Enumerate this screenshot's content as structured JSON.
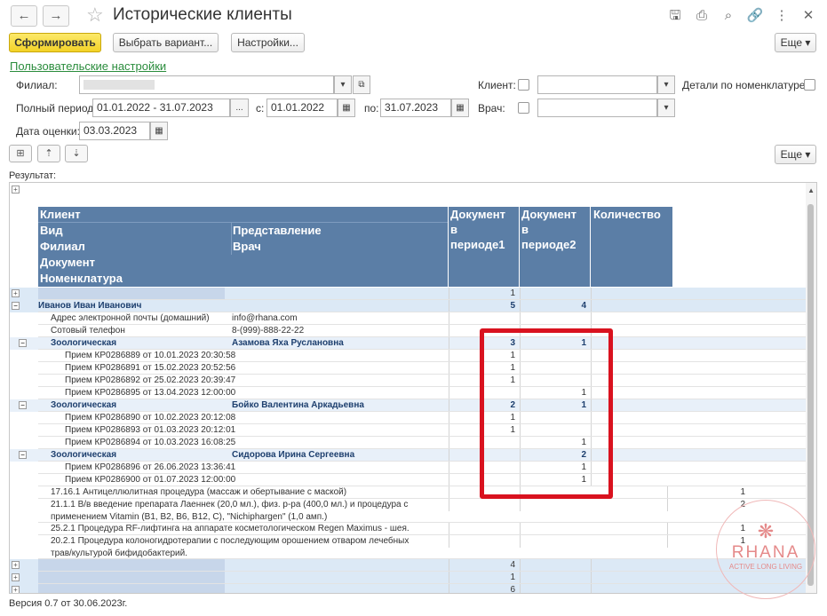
{
  "window": {
    "title": "Исторические клиенты",
    "nav_back": "←",
    "nav_forward": "→",
    "star": "☆",
    "icons": [
      "save-icon",
      "print-icon",
      "preview-icon",
      "link-icon",
      "more-icon",
      "close-icon"
    ],
    "icon_glyphs": [
      "🖫",
      "⎙",
      "⌕",
      "🔗",
      "⋮",
      "✕"
    ]
  },
  "toolbar": {
    "generate_label": "Сформировать",
    "variant_label": "Выбрать вариант...",
    "settings_label": "Настройки...",
    "more_label": "Еще ▾"
  },
  "user_settings_link": "Пользовательские настройки",
  "filters": {
    "branch_label": "Филиал:",
    "branch_value": "",
    "full_period_label": "Полный период:",
    "full_period_value": "01.01.2022 - 31.07.2023",
    "period_btn": "...",
    "from_label": "с:",
    "from_value": "01.01.2022",
    "to_label": "по:",
    "to_value": "31.07.2023",
    "assess_date_label": "Дата оценки:",
    "assess_date_value": "03.03.2023",
    "client_label": "Клиент:",
    "doctor_label": "Врач:",
    "details_label": "Детали по номенклатуре:"
  },
  "result_label": "Результат:",
  "more2_label": "Еще ▾",
  "table": {
    "headers": {
      "client": "Клиент",
      "kind": "Вид",
      "representation": "Представление",
      "branch": "Филиал",
      "doctor": "Врач",
      "document": "Документ",
      "nomenclature": "Номенклатура",
      "doc_period1": [
        "Документ",
        "в",
        "периоде1"
      ],
      "doc_period2": [
        "Документ",
        "в",
        "периоде2"
      ],
      "quantity": "Количество"
    },
    "rows": [
      {
        "type": "blur",
        "a": "",
        "b": "",
        "p1": "1",
        "p2": "",
        "q": ""
      },
      {
        "type": "client",
        "a": "Иванов Иван Иванович",
        "b": "",
        "p1": "5",
        "p2": "4",
        "q": ""
      },
      {
        "type": "info",
        "a": "Адрес электронной почты (домашний)",
        "b": "info@rhana.com",
        "p1": "",
        "p2": "",
        "q": ""
      },
      {
        "type": "info",
        "a": "Сотовый телефон",
        "b": "8-(999)-888-22-22",
        "p1": "",
        "p2": "",
        "q": ""
      },
      {
        "type": "group",
        "a": "Зоологическая",
        "b": "Азамова Яха Руслановна",
        "p1": "3",
        "p2": "1",
        "q": ""
      },
      {
        "type": "doc",
        "a": "Прием КР0286889 от 10.01.2023 20:30:58",
        "b": "",
        "p1": "1",
        "p2": "",
        "q": ""
      },
      {
        "type": "doc",
        "a": "Прием КР0286891 от 15.02.2023 20:52:56",
        "b": "",
        "p1": "1",
        "p2": "",
        "q": ""
      },
      {
        "type": "doc",
        "a": "Прием КР0286892 от 25.02.2023 20:39:47",
        "b": "",
        "p1": "1",
        "p2": "",
        "q": ""
      },
      {
        "type": "doc",
        "a": "Прием КР0286895 от 13.04.2023 12:00:00",
        "b": "",
        "p1": "",
        "p2": "1",
        "q": ""
      },
      {
        "type": "group",
        "a": "Зоологическая",
        "b": "Бойко Валентина Аркадьевна",
        "p1": "2",
        "p2": "1",
        "q": ""
      },
      {
        "type": "doc",
        "a": "Прием КР0286890 от 10.02.2023 20:12:08",
        "b": "",
        "p1": "1",
        "p2": "",
        "q": ""
      },
      {
        "type": "doc",
        "a": "Прием КР0286893 от 01.03.2023 20:12:01",
        "b": "",
        "p1": "1",
        "p2": "",
        "q": ""
      },
      {
        "type": "doc",
        "a": "Прием КР0286894 от 10.03.2023 16:08:25",
        "b": "",
        "p1": "",
        "p2": "1",
        "q": ""
      },
      {
        "type": "group",
        "a": "Зоологическая",
        "b": "Сидорова Ирина Сергеевна",
        "p1": "",
        "p2": "2",
        "q": ""
      },
      {
        "type": "doc",
        "a": "Прием КР0286896 от 26.06.2023 13:36:41",
        "b": "",
        "p1": "",
        "p2": "1",
        "q": ""
      },
      {
        "type": "doc",
        "a": "Прием КР0286900 от 01.07.2023 12:00:00",
        "b": "",
        "p1": "",
        "p2": "1",
        "q": ""
      },
      {
        "type": "nom",
        "a": "17.16.1 Антицеллюлитная процедура (массаж и обертывание с маской)",
        "b": "",
        "p1": "",
        "p2": "",
        "q": "1"
      },
      {
        "type": "nom2",
        "a": "21.1.1 В/в введение препарата Лаеннек (20,0 мл.), физ. р-ра (400,0 мл.) и процедура с",
        "a2": "применением Vitamin (B1, B2, B6, B12, C), \"Nichiphargen\" (1,0 амп.)",
        "b": "",
        "p1": "",
        "p2": "",
        "q": "2"
      },
      {
        "type": "nom",
        "a": "25.2.1 Процедура RF-лифтинга на  аппарате  косметологическом  Regen Maximus - шея.",
        "b": "",
        "p1": "",
        "p2": "",
        "q": "1"
      },
      {
        "type": "nom2",
        "a": "20.2.1 Процедура колоногидротерапии с последующим орошением отваром лечебных",
        "a2": "трав/культурой бифидобактерий.",
        "b": "",
        "p1": "",
        "p2": "",
        "q": "1"
      },
      {
        "type": "blur",
        "a": "",
        "b": "",
        "p1": "4",
        "p2": "",
        "q": ""
      },
      {
        "type": "blur",
        "a": "",
        "b": "",
        "p1": "1",
        "p2": "",
        "q": ""
      },
      {
        "type": "blur",
        "a": "",
        "b": "",
        "p1": "6",
        "p2": "",
        "q": ""
      }
    ]
  },
  "version": "Версия 0.7 от 30.06.2023г.",
  "watermark": {
    "brand": "RHANA",
    "tagline": "ACTIVE LONG LIVING"
  },
  "colors": {
    "header_bg": "#5b7ea6",
    "group_bg": "#dce9f6",
    "highlight": "#d9121f",
    "primary_btn": "#f3d227",
    "link": "#2a8c3c"
  }
}
